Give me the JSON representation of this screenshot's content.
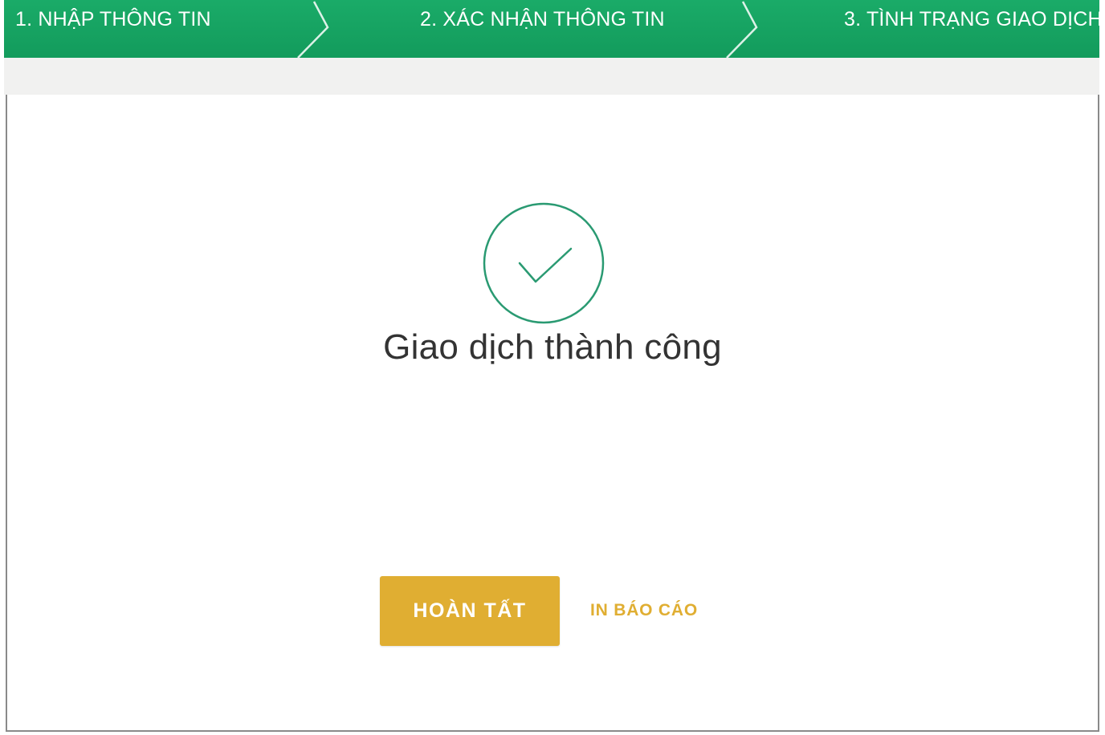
{
  "stepper": {
    "steps": [
      {
        "label": "1. NHẬP THÔNG TIN"
      },
      {
        "label": "2. XÁC NHẬN THÔNG TIN"
      },
      {
        "label": "3. TÌNH TRẠNG GIAO DỊCH"
      }
    ],
    "color": "#17a865"
  },
  "result": {
    "icon": "check-circle-icon",
    "icon_color": "#2a9a72",
    "message": "Giao dịch thành công"
  },
  "actions": {
    "done_label": "HOÀN TẤT",
    "print_label": "IN BÁO CÁO",
    "accent_color": "#e0ae32"
  }
}
